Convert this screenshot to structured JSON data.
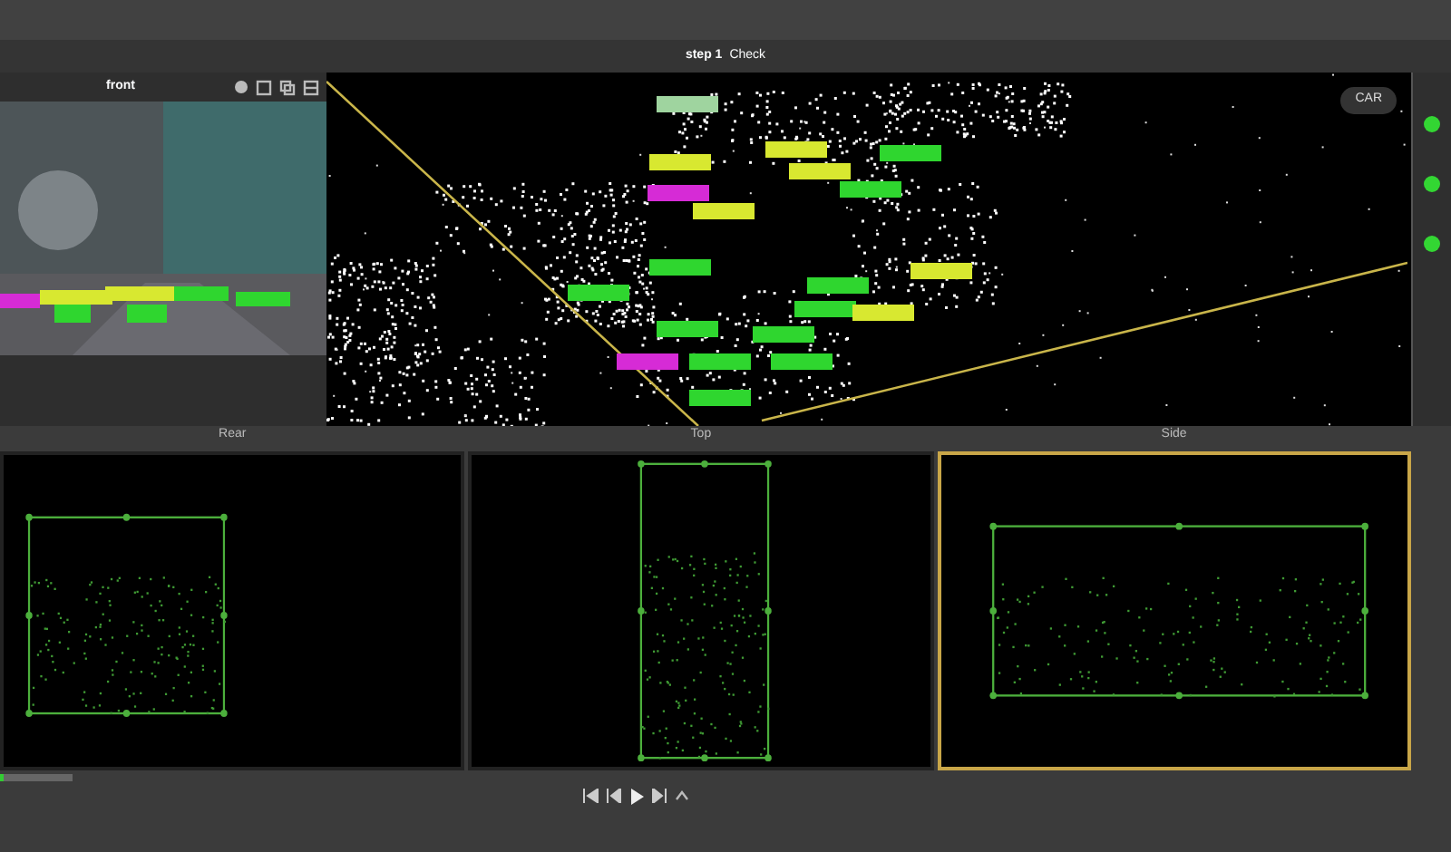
{
  "toolbar": {
    "stage": "step 1",
    "phase": "Check"
  },
  "camera": {
    "label": "front"
  },
  "main_view": {
    "mode": "CAR"
  },
  "sidebar": {
    "items": [
      {
        "color": "#33d633"
      },
      {
        "color": "#33d633"
      },
      {
        "color": "#33d633"
      }
    ]
  },
  "views": [
    {
      "label": "Rear",
      "selected": false
    },
    {
      "label": "Top",
      "selected": false
    },
    {
      "label": "Side",
      "selected": true
    }
  ],
  "timeline": {
    "level": 0.05
  }
}
